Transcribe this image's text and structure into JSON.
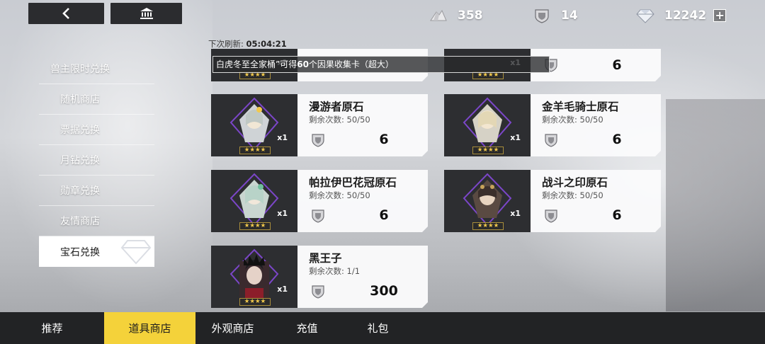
{
  "resources": [
    {
      "icon": "silver-crystal-icon",
      "value": "358"
    },
    {
      "icon": "badge-shield-icon",
      "value": "14"
    },
    {
      "icon": "diamond-icon",
      "value": "12242"
    }
  ],
  "topbar": {
    "plus": "+"
  },
  "refresh": {
    "label": "下次刷新:",
    "time": "05:04:21"
  },
  "banner": {
    "text_prefix": "白虎冬至全家桶”可得",
    "count": "60",
    "text_suffix": "个因果收集卡（超大）"
  },
  "sidebar": {
    "header": "兽主限时兑换",
    "items": [
      "随机商店",
      "票据兑换",
      "月钻兑换",
      "勋章兑换",
      "友情商店",
      "宝石兑换"
    ],
    "active_index": 5
  },
  "partial_prices": [
    "6"
  ],
  "cards": [
    {
      "name": "漫游者原石",
      "remain_label": "剩余次数:",
      "remain": "50/50",
      "price": "6",
      "qty": "x1",
      "stars": "★★★★"
    },
    {
      "name": "金羊毛骑士原石",
      "remain_label": "剩余次数:",
      "remain": "50/50",
      "price": "6",
      "qty": "x1",
      "stars": "★★★★"
    },
    {
      "name": "帕拉伊巴花冠原石",
      "remain_label": "剩余次数:",
      "remain": "50/50",
      "price": "6",
      "qty": "x1",
      "stars": "★★★★"
    },
    {
      "name": "战斗之印原石",
      "remain_label": "剩余次数:",
      "remain": "50/50",
      "price": "6",
      "qty": "x1",
      "stars": "★★★★"
    },
    {
      "name": "黑王子",
      "remain_label": "剩余次数:",
      "remain": "1/1",
      "price": "300",
      "qty": "x1",
      "stars": "★★★★"
    }
  ],
  "partial_cards": [
    {
      "qty": "x1",
      "stars": "★★★★"
    },
    {
      "qty": "x1",
      "stars": "★★★★"
    }
  ],
  "tabs": [
    "推荐",
    "道具商店",
    "外观商店",
    "充值",
    "礼包"
  ],
  "active_tab": 1,
  "colors": {
    "accent": "#f4d23a",
    "dark": "#222325",
    "purple": "#7b46c8"
  }
}
